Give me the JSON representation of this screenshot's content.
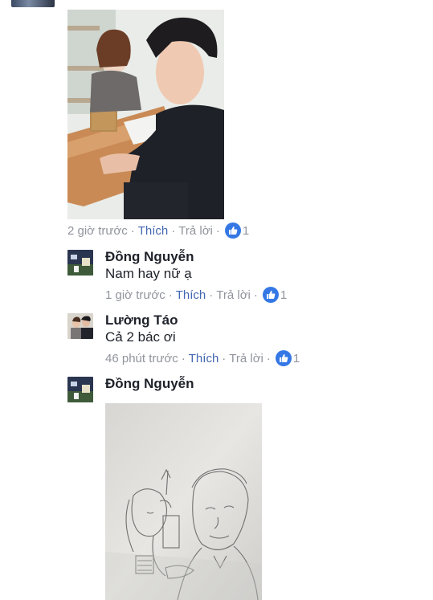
{
  "comments": [
    {
      "time": "2 giờ trước",
      "like_label": "Thích",
      "reply_label": "Trả lời",
      "separator": "·",
      "like_count": "1"
    },
    {
      "author": "Đồng Nguyễn",
      "text": "Nam hay nữ ạ",
      "time": "1 giờ trước",
      "like_label": "Thích",
      "reply_label": "Trả lời",
      "separator": "·",
      "like_count": "1"
    },
    {
      "author": "Lường Táo",
      "text": "Cả 2 bác ơi",
      "time": "46 phút trước",
      "like_label": "Thích",
      "reply_label": "Trả lời",
      "separator": "·",
      "like_count": "1"
    },
    {
      "author": "Đồng Nguyễn"
    }
  ],
  "icons": {
    "like": "thumbs-up-icon"
  },
  "colors": {
    "link": "#4267b2",
    "meta": "#90949c",
    "like_badge": "#3578e5",
    "text": "#1d2129"
  }
}
